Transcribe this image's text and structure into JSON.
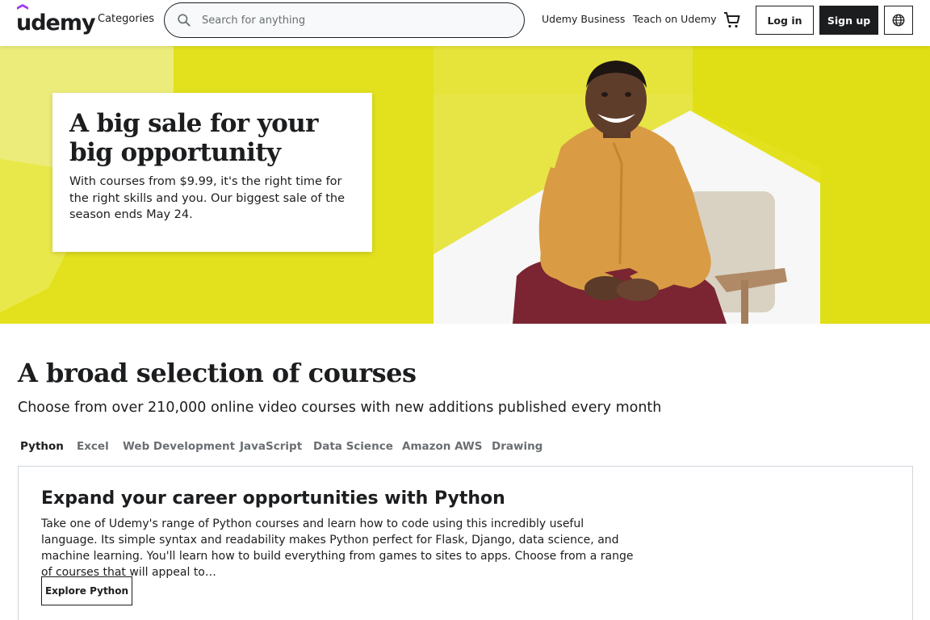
{
  "header": {
    "logo_text": "udemy",
    "categories_label": "Categories",
    "search": {
      "placeholder": "Search for anything",
      "value": ""
    },
    "business_link": "Udemy Business",
    "teach_link": "Teach on Udemy",
    "login_label": "Log in",
    "signup_label": "Sign up"
  },
  "hero": {
    "title": "A big sale for your big opportunity",
    "body": "With courses from $9.99, it's the right time for the right skills and you. Our biggest sale of the season ends May 24.",
    "background_color": "#e3e11d"
  },
  "courses": {
    "title": "A broad selection of courses",
    "subtitle": "Choose from over 210,000 online video courses with new additions published every month",
    "tabs": [
      {
        "label": "Python",
        "active": true
      },
      {
        "label": "Excel",
        "active": false
      },
      {
        "label": "Web Development",
        "active": false
      },
      {
        "label": "JavaScript",
        "active": false
      },
      {
        "label": "Data Science",
        "active": false
      },
      {
        "label": "Amazon AWS",
        "active": false
      },
      {
        "label": "Drawing",
        "active": false
      }
    ],
    "panel": {
      "title": "Expand your career opportunities with Python",
      "body": "Take one of Udemy's range of Python courses and learn how to code using this incredibly useful language. Its simple syntax and readability makes Python perfect for Flask, Django, data science, and machine learning. You'll learn how to build everything from games to sites to apps. Choose from a range of courses that will appeal to…",
      "button_label": "Explore Python"
    }
  },
  "icons": {
    "logo": "udemy-logo",
    "search": "search-icon",
    "cart": "cart-icon",
    "language": "globe-icon"
  },
  "colors": {
    "brand_purple": "#a435f0",
    "text": "#1c1d1f",
    "muted": "#6a6f73"
  }
}
